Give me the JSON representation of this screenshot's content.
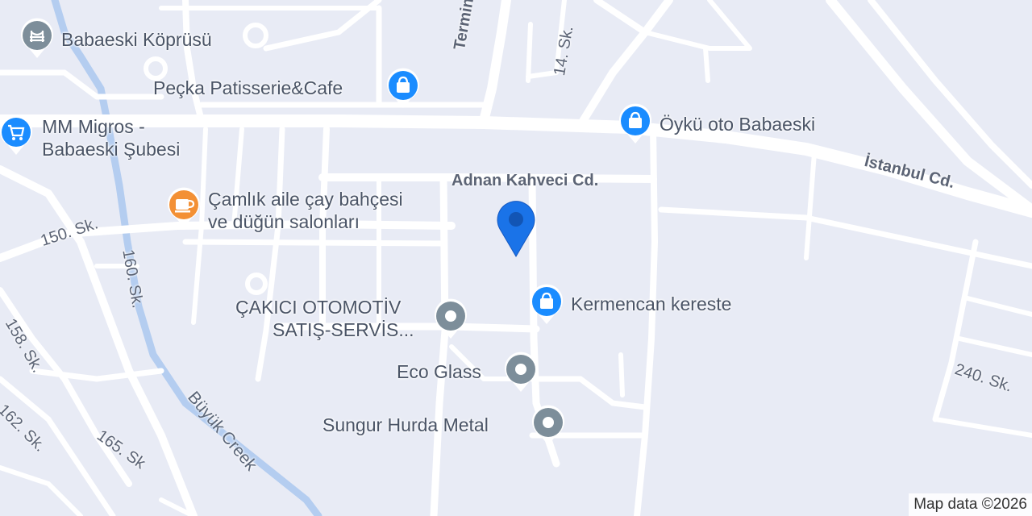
{
  "colors": {
    "background": "#e8ebf5",
    "road": "#ffffff",
    "creek": "#b4cdf0",
    "shopping_pin": "#1a8cff",
    "cafe_pin": "#f39035",
    "generic_pin": "#7d8e9a",
    "location_pin": "#1a73e8"
  },
  "pois": [
    {
      "label": "Babaeski Köprüsü",
      "icon": "bridge-icon",
      "category": "landmark"
    },
    {
      "label": "Peçka Patisserie&Cafe",
      "icon": "shopping-bag-icon",
      "category": "shopping"
    },
    {
      "label": "MM Migros -",
      "label2": "Babaeski Şubesi",
      "icon": "shopping-cart-icon",
      "category": "shopping"
    },
    {
      "label": "Öykü oto Babaeski",
      "icon": "shopping-bag-icon",
      "category": "shopping"
    },
    {
      "label": "Çamlık aile çay bahçesi",
      "label2": "ve düğün salonları",
      "icon": "coffee-cup-icon",
      "category": "cafe"
    },
    {
      "label": "Kermencan kereste",
      "icon": "shopping-bag-icon",
      "category": "shopping"
    },
    {
      "label": "ÇAKICI OTOMOTİV",
      "label2": "SATIŞ-SERVİS...",
      "icon": "place-dot-icon",
      "category": "generic"
    },
    {
      "label": "Eco Glass",
      "icon": "place-dot-icon",
      "category": "generic"
    },
    {
      "label": "Sungur Hurda Metal",
      "icon": "place-dot-icon",
      "category": "generic"
    }
  ],
  "streets": {
    "terminal": "Terminal Cd.",
    "sk14": "14. Sk.",
    "adnan": "Adnan Kahveci Cd.",
    "istanbul": "İstanbul Cd.",
    "sk150": "150. Sk.",
    "sk160": "160. Sk.",
    "sk158": "158. Sk.",
    "sk162": "162. Sk.",
    "sk165": "165. Sk",
    "sk240": "240. Sk.",
    "creek": "Büyük Creek"
  },
  "attribution": "Map data ©2026"
}
